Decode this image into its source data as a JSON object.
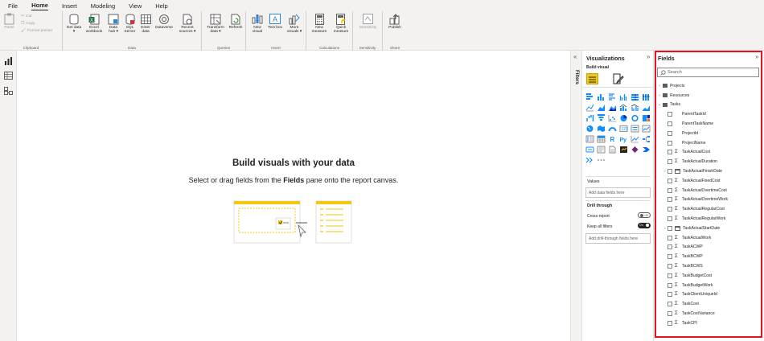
{
  "menu": {
    "tabs": [
      "File",
      "Home",
      "Insert",
      "Modeling",
      "View",
      "Help"
    ],
    "active_tab": "Home"
  },
  "ribbon": {
    "clipboard": {
      "paste": "Paste",
      "cut": "Cut",
      "copy": "Copy",
      "format_painter": "Format painter",
      "label": "Clipboard"
    },
    "data": {
      "get_data": "Get data ▾",
      "excel_workbook": "Excel workbook",
      "data_hub": "Data hub ▾",
      "sql_server": "SQL Server",
      "enter_data": "Enter data",
      "dataverse": "Dataverse",
      "recent_sources": "Recent sources ▾",
      "label": "Data"
    },
    "queries": {
      "transform_data": "Transform data ▾",
      "refresh": "Refresh",
      "label": "Queries"
    },
    "insert": {
      "new_visual": "New visual",
      "text_box": "Text box",
      "more_visuals": "More visuals ▾",
      "label": "Insert"
    },
    "calculations": {
      "new_measure": "New measure",
      "quick_measure": "Quick measure",
      "label": "Calculations"
    },
    "sensitivity": {
      "sensitivity": "Sensitivity",
      "label": "Sensitivity"
    },
    "share": {
      "publish": "Publish",
      "label": "Share"
    }
  },
  "canvas": {
    "title": "Build visuals with your data",
    "subtitle_before": "Select or drag fields from the ",
    "subtitle_bold": "Fields",
    "subtitle_after": " pane onto the report canvas."
  },
  "filters": {
    "label": "Filters"
  },
  "visualizations": {
    "title": "Visualizations",
    "build_visual": "Build visual",
    "values_label": "Values",
    "values_placeholder": "Add data fields here",
    "drill_through": "Drill through",
    "cross_report": "Cross-report",
    "cross_report_state": "Off",
    "keep_all_filters": "Keep all filters",
    "keep_all_filters_state": "On",
    "drill_placeholder": "Add drill-through fields here"
  },
  "fields": {
    "title": "Fields",
    "search_placeholder": "Search",
    "items": [
      {
        "type": "table",
        "name": "Projects",
        "expanded": false
      },
      {
        "type": "table",
        "name": "Resources",
        "expanded": false
      },
      {
        "type": "table",
        "name": "Tasks",
        "expanded": true
      },
      {
        "type": "text",
        "name": "ParentTaskId"
      },
      {
        "type": "text",
        "name": "ParentTaskName"
      },
      {
        "type": "text",
        "name": "ProjectId"
      },
      {
        "type": "text",
        "name": "ProjectName"
      },
      {
        "type": "sum",
        "name": "TaskActualCost"
      },
      {
        "type": "sum",
        "name": "TaskActualDuration"
      },
      {
        "type": "date",
        "name": "TaskActualFinishDate"
      },
      {
        "type": "sum",
        "name": "TaskActualFixedCost"
      },
      {
        "type": "sum",
        "name": "TaskActualOvertimeCost"
      },
      {
        "type": "sum",
        "name": "TaskActualOvertimeWork"
      },
      {
        "type": "sum",
        "name": "TaskActualRegularCost"
      },
      {
        "type": "sum",
        "name": "TaskActualRegularWork"
      },
      {
        "type": "date",
        "name": "TaskActualStartDate"
      },
      {
        "type": "sum",
        "name": "TaskActualWork"
      },
      {
        "type": "sum",
        "name": "TaskACWP"
      },
      {
        "type": "sum",
        "name": "TaskBCWP"
      },
      {
        "type": "sum",
        "name": "TaskBCWS"
      },
      {
        "type": "sum",
        "name": "TaskBudgetCost"
      },
      {
        "type": "sum",
        "name": "TaskBudgetWork"
      },
      {
        "type": "sum",
        "name": "TaskClientUniqueId"
      },
      {
        "type": "sum",
        "name": "TaskCost"
      },
      {
        "type": "sum",
        "name": "TaskCostVariance"
      },
      {
        "type": "sum",
        "name": "TaskCPI"
      }
    ]
  },
  "colors": {
    "accent_yellow": "#f2c811",
    "highlight_red": "#e81123",
    "ribbon_bg": "#f3f2f1"
  }
}
